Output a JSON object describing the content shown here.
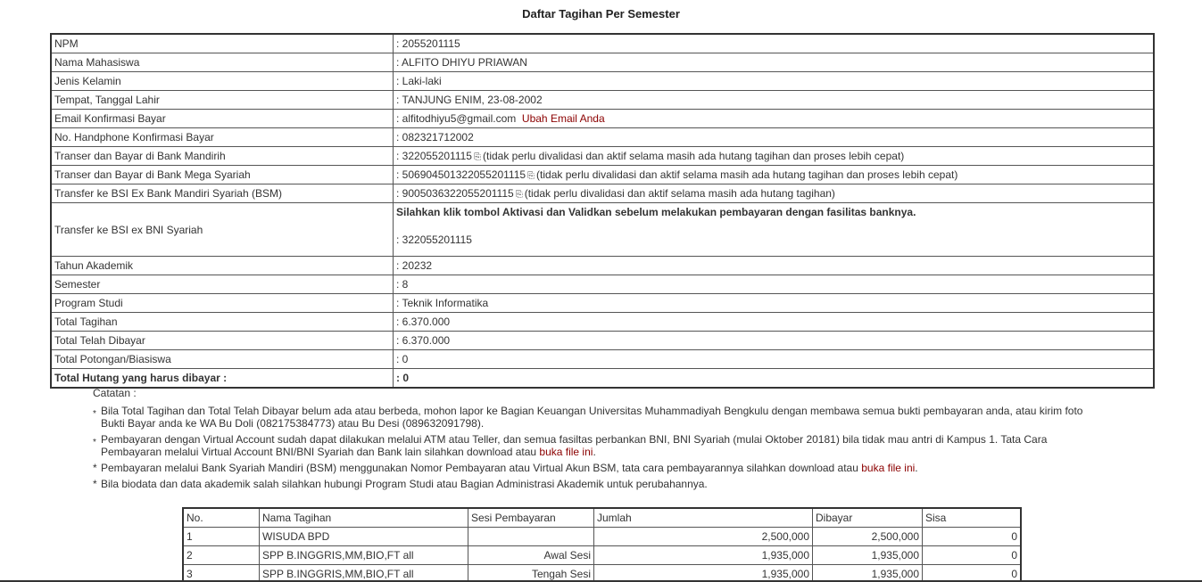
{
  "title": "Daftar Tagihan Per Semester",
  "info": {
    "npm": {
      "label": "NPM",
      "value": ": 2055201115"
    },
    "nama": {
      "label": "Nama Mahasiswa",
      "value": ": ALFITO DHIYU PRIAWAN"
    },
    "jk": {
      "label": "Jenis Kelamin",
      "value": ": Laki-laki"
    },
    "ttl": {
      "label": "Tempat, Tanggal Lahir",
      "value": ": TANJUNG ENIM, 23-08-2002"
    },
    "email": {
      "label": "Email Konfirmasi Bayar",
      "value": ": alfitodhiyu5@gmail.com",
      "link": "Ubah Email Anda"
    },
    "hp": {
      "label": "No. Handphone Konfirmasi Bayar",
      "value": ": 082321712002"
    },
    "mandiri": {
      "label": "Transer dan Bayar di Bank Mandirih",
      "value": ": 322055201115",
      "note": "(tidak perlu divalidasi dan aktif selama masih ada hutang tagihan dan proses lebih cepat)"
    },
    "mega": {
      "label": "Transer dan Bayar di Bank Mega Syariah",
      "value": ": 506904501322055201115",
      "note": "(tidak perlu divalidasi dan aktif selama masih ada hutang tagihan dan proses lebih cepat)"
    },
    "bsm": {
      "label": "Transfer ke BSI Ex Bank Mandiri Syariah (BSM)",
      "value": ": 9005036322055201115",
      "note": "(tidak perlu divalidasi dan aktif selama masih ada hutang tagihan)"
    },
    "bni": {
      "label": "Transfer ke BSI ex BNI Syariah",
      "notice": "Silahkan klik tombol Aktivasi dan Validkan sebelum melakukan pembayaran dengan fasilitas banknya.",
      "value": ": 322055201115"
    },
    "tahun": {
      "label": "Tahun Akademik",
      "value": ": 20232"
    },
    "semester": {
      "label": "Semester",
      "value": ": 8"
    },
    "prodi": {
      "label": "Program Studi",
      "value": ": Teknik Informatika"
    },
    "total_tagihan": {
      "label": "Total Tagihan",
      "value": ": 6.370.000"
    },
    "total_dibayar": {
      "label": "Total Telah Dibayar",
      "value": ": 6.370.000"
    },
    "potongan": {
      "label": "Total Potongan/Biasiswa",
      "value": ": 0"
    },
    "hutang": {
      "label": "Total Hutang yang harus dibayar :",
      "value": ":  0"
    }
  },
  "icon": "copy-icon",
  "notes": {
    "caption": "Catatan :",
    "n1": "Bila Total Tagihan dan Total Telah Dibayar belum ada atau berbeda, mohon lapor ke Bagian Keuangan Universitas Muhammadiyah Bengkulu dengan membawa semua bukti pembayaran anda, atau kirim foto Bukti Bayar anda ke WA Bu Doli (082175384773) atau Bu Desi (089632091798).",
    "n2": "Pembayaran dengan Virtual Account sudah dapat dilakukan melalui ATM atau Teller, dan semua fasiltas perbankan BNI, BNI Syariah (mulai Oktober 20181) bila tidak mau antri di Kampus 1. Tata Cara Pembayaran melalui Virtual Account BNI/BNI Syariah dan Bank lain silahkan download atau",
    "n2_link": "buka file ini",
    "n3": "Pembayaran melalui Bank Syariah Mandiri (BSM) menggunakan Nomor Pembayaran atau Virtual Akun BSM, tata cara pembayarannya silahkan download atau",
    "n3_link": "buka file ini",
    "n4": "Bila biodata dan data akademik salah silahkan hubungi Program Studi atau Bagian Administrasi Akademik untuk perubahannya.",
    "star": "*",
    "dot": "."
  },
  "bills": {
    "headers": [
      "No.",
      "Nama Tagihan",
      "Sesi Pembayaran",
      "Jumlah",
      "Dibayar",
      "Sisa"
    ],
    "rows": [
      [
        "1",
        "WISUDA BPD",
        "",
        "2,500,000",
        "2,500,000",
        "0"
      ],
      [
        "2",
        "SPP B.INGGRIS,MM,BIO,FT all",
        "Awal Sesi",
        "1,935,000",
        "1,935,000",
        "0"
      ],
      [
        "3",
        "SPP B.INGGRIS,MM,BIO,FT all",
        "Tengah Sesi",
        "1,935,000",
        "1,935,000",
        "0"
      ]
    ]
  }
}
